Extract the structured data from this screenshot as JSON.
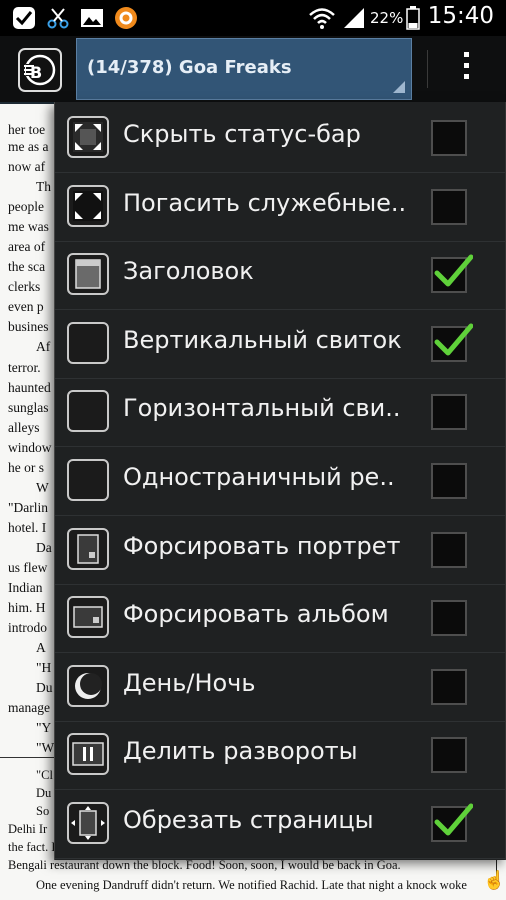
{
  "status_bar": {
    "time": "15:40",
    "battery": "22%",
    "icons": [
      "check-icon",
      "scissors-icon",
      "image-icon",
      "orange-circle-icon",
      "wifi-icon",
      "signal-icon",
      "battery-icon"
    ]
  },
  "action_bar": {
    "title": "(14/378) Goa Freaks",
    "logo": "eb-logo-icon",
    "overflow": "overflow-menu-icon"
  },
  "book": {
    "lines": [
      "her toe",
      "me as a",
      "now af",
      "Th",
      "people",
      "me was",
      "area of",
      "the sca",
      "clerks",
      "even p",
      "busines",
      "Af",
      "terror.",
      "haunted",
      "sunglas",
      "alleys",
      "window",
      "he or s",
      "W",
      "\"Darlin",
      "hotel. I",
      "Da",
      "us flew",
      "Indian",
      "him. H",
      "introdo",
      "A",
      "\"H",
      "Du",
      "manage",
      "\"Y",
      "\"W"
    ],
    "lower_lines": [
      "\"Cl",
      "Du",
      "So",
      "Delhi Ir",
      "the fact. H",
      "Bengali restaurant down the block. Food! Soon, soon, I would be back in Goa.",
      "One evening Dandruff didn't return. We notified Rachid. Late that night a knock woke"
    ]
  },
  "menu": {
    "items": [
      {
        "label": "Скрыть статус-бар",
        "icon": "hide-statusbar-icon",
        "checked": false
      },
      {
        "label": "Погасить служебные..",
        "icon": "dim-service-icon",
        "checked": false
      },
      {
        "label": "Заголовок",
        "icon": "header-icon",
        "checked": true
      },
      {
        "label": "Вертикальный свиток",
        "icon": "vertical-scroll-icon",
        "checked": true
      },
      {
        "label": "Горизонтальный сви..",
        "icon": "horizontal-scroll-icon",
        "checked": false
      },
      {
        "label": "Одностраничный ре..",
        "icon": "single-page-icon",
        "checked": false
      },
      {
        "label": "Форсировать портрет",
        "icon": "force-portrait-icon",
        "checked": false
      },
      {
        "label": "Форсировать альбом",
        "icon": "force-landscape-icon",
        "checked": false
      },
      {
        "label": "День/Ночь",
        "icon": "day-night-icon",
        "checked": false
      },
      {
        "label": "Делить развороты",
        "icon": "split-spreads-icon",
        "checked": false
      },
      {
        "label": "Обрезать страницы",
        "icon": "crop-pages-icon",
        "checked": true
      }
    ]
  },
  "colors": {
    "accent_check": "#5fd13a",
    "title_bg": "#325576",
    "menu_bg": "#1f2122"
  }
}
